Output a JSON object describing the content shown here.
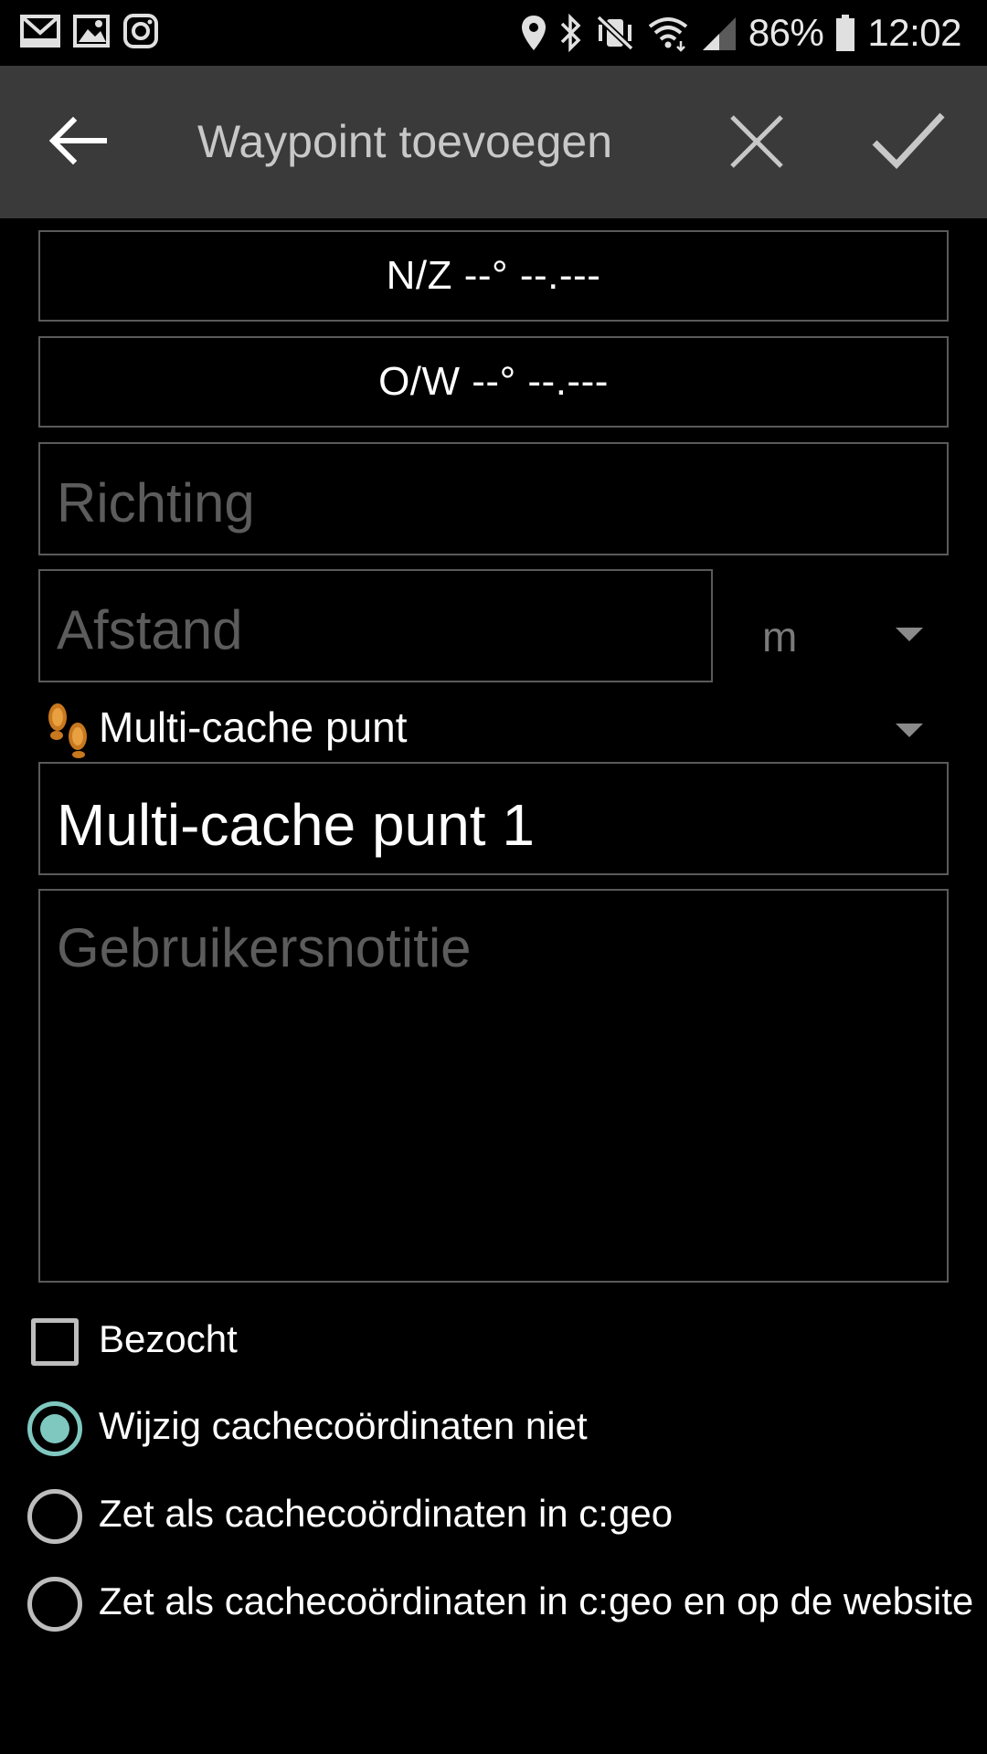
{
  "status_bar": {
    "left_icons": [
      "gmail-icon",
      "gallery-icon",
      "instagram-icon"
    ],
    "right_icons": [
      "location-icon",
      "bluetooth-icon",
      "vibrate-mute-icon",
      "wifi-icon",
      "signal-icon",
      "battery-icon"
    ],
    "battery": "86%",
    "time": "12:02"
  },
  "toolbar": {
    "title": "Waypoint toevoegen",
    "back_icon": "arrow-back-icon",
    "cancel_icon": "close-icon",
    "confirm_icon": "check-icon"
  },
  "form": {
    "latitude_button": "N/Z --° --.---",
    "longitude_button": "O/W --° --.---",
    "bearing_placeholder": "Richting",
    "distance_placeholder": "Afstand",
    "distance_unit": "m",
    "waypoint_type": "Multi-cache punt",
    "waypoint_type_icon": "footprints-icon",
    "name_value": "Multi-cache punt 1",
    "note_placeholder": "Gebruikersnotitie",
    "visited_label": "Bezocht",
    "visited_checked": false,
    "coord_options": [
      {
        "label": "Wijzig cachecoördinaten niet",
        "selected": true
      },
      {
        "label": "Zet als cachecoördinaten in c:geo",
        "selected": false
      },
      {
        "label": "Zet als cachecoördinaten in c:geo en op de website",
        "selected": false
      }
    ]
  },
  "colors": {
    "toolbar_bg": "#3a3a3a",
    "accent": "#7fc8c0",
    "border": "#5a5a5a",
    "placeholder": "#5c5c5c"
  }
}
